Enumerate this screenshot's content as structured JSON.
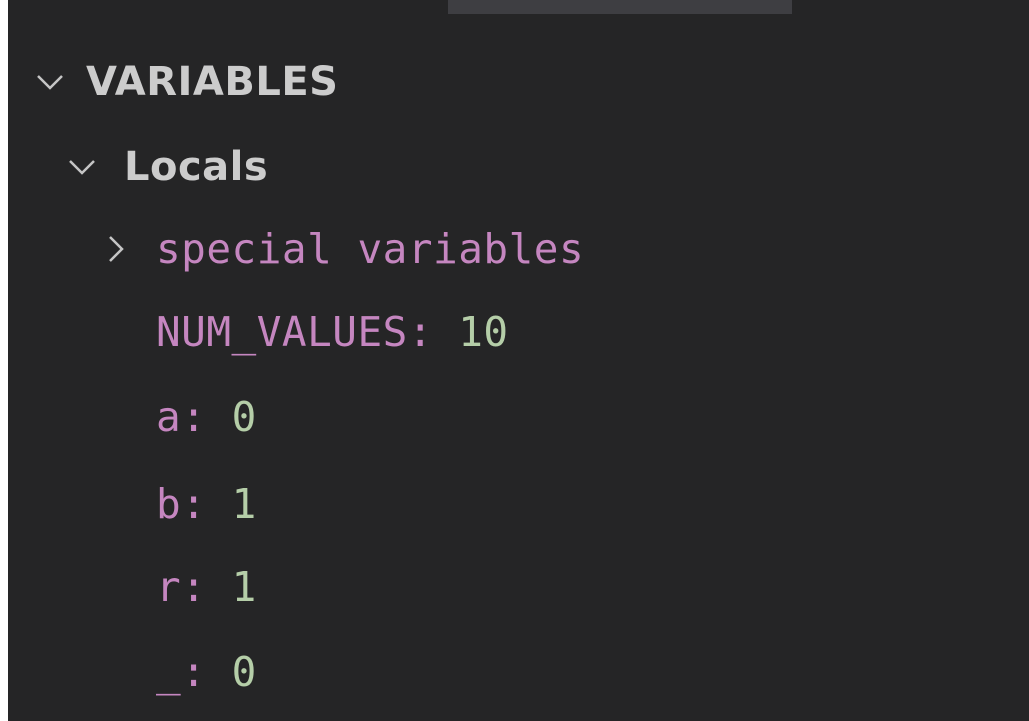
{
  "panel": {
    "section_title": "VARIABLES",
    "scope": {
      "label": "Locals",
      "expanded": true
    },
    "special_variables": {
      "label": "special variables",
      "expanded": false
    },
    "variables": [
      {
        "name": "NUM_VALUES",
        "value": "10"
      },
      {
        "name": "a",
        "value": "0"
      },
      {
        "name": "b",
        "value": "1"
      },
      {
        "name": "r",
        "value": "1"
      },
      {
        "name": "_",
        "value": "0"
      }
    ]
  },
  "colors": {
    "background": "#252526",
    "section_text": "#cccccc",
    "variable_name": "#c586c0",
    "variable_value": "#b5cea8",
    "chevron": "#c5c5c5"
  },
  "icons": {
    "section_chevron": "chevron-down-icon",
    "scope_chevron": "chevron-down-icon",
    "special_chevron": "chevron-right-icon"
  }
}
